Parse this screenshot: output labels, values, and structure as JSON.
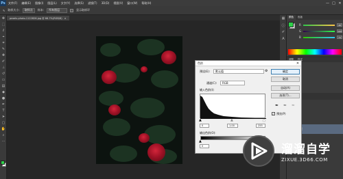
{
  "app": {
    "logo_text": "Ps"
  },
  "menubar": {
    "items": [
      "文件(F)",
      "编辑(E)",
      "图像(I)",
      "图层(L)",
      "文字(Y)",
      "选择(S)",
      "滤镜(T)",
      "3D(D)",
      "视图(V)",
      "窗口(W)",
      "帮助(H)"
    ],
    "minimize": "—",
    "maximize": "□",
    "close": "✕"
  },
  "options": {
    "size_label": "取样大小:",
    "size_value": "取样点",
    "sample_label": "样本:",
    "sample_value": "所有图层",
    "show_ring": "显示取样环"
  },
  "document": {
    "tab_title": "pexels-photo-1122826.jpg @ 66.7%(RGB/8)",
    "close": "×"
  },
  "colors": {
    "foreground": "#2fd04a",
    "background": "#ffffff",
    "accent": "#3c7fb1"
  },
  "color_panel": {
    "tabs": [
      "颜色",
      "色板"
    ],
    "r_label": "R",
    "g_label": "G",
    "b_label": "B",
    "r_value": "48",
    "g_value": "199",
    "b_value": "74"
  },
  "adjust_panel": {
    "tabs": [
      "调整",
      "样式"
    ]
  },
  "layers_panel": {
    "rows": [
      "图层",
      "类型",
      "正常",
      "锁定:",
      "背景"
    ]
  },
  "dialog": {
    "title": "色阶",
    "close": "✕",
    "preset_label": "预设(E):",
    "preset_value": "默认值",
    "preset_icon": "gear-icon",
    "channel_label": "通道(C):",
    "channel_value": "RGB",
    "input_label": "输入色阶(I):",
    "input_black": "0",
    "input_gamma": "1.00",
    "input_white": "255",
    "output_label": "输出色阶(O):",
    "output_black": "0",
    "buttons": [
      "确定",
      "取消",
      "自动(A)",
      "选项(T)..."
    ],
    "preview_label": "预览(P)"
  },
  "watermark": {
    "title": "溜溜自学",
    "subtitle": "ZIXUE.3D66.COM"
  }
}
